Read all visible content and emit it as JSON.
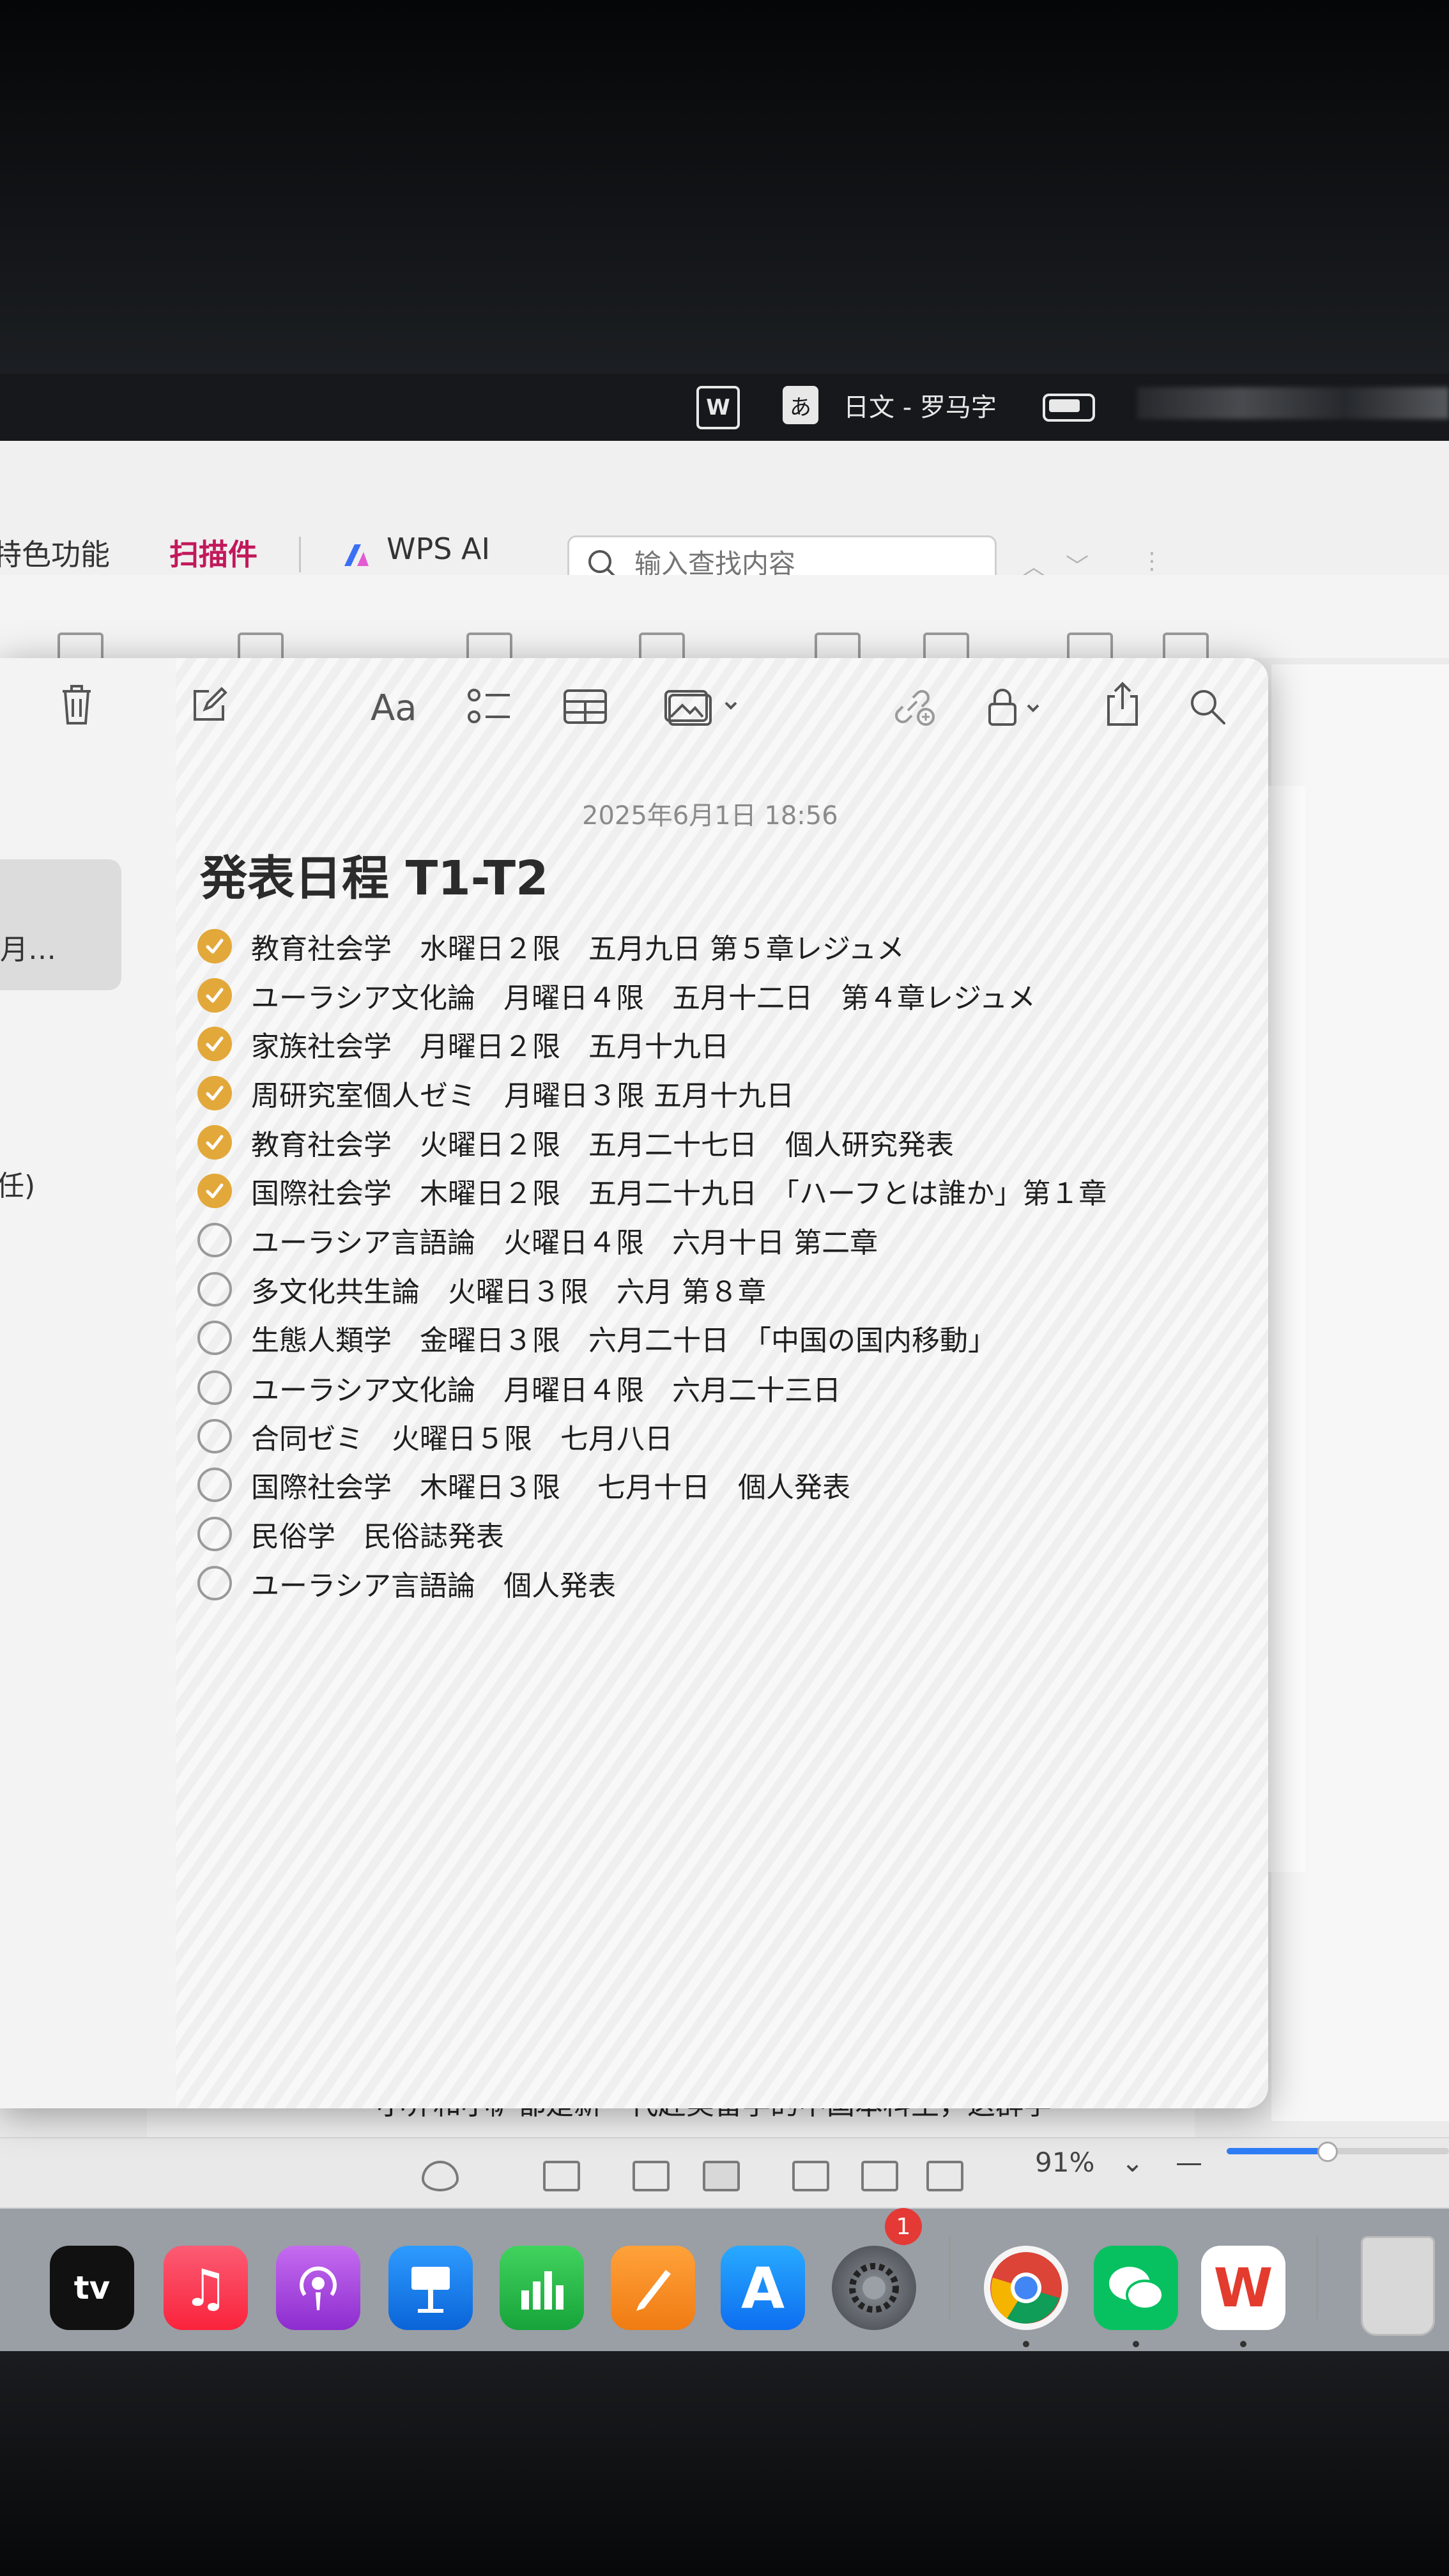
{
  "menubar": {
    "wps_icon": "wps-logo-icon",
    "input_source": "あ",
    "ime_name": "日文 - 罗马字"
  },
  "wps": {
    "tabs": [
      "特色功能",
      "扫描件",
      "WPS AI"
    ],
    "search_placeholder": "输入查找内容",
    "doc_text": "小乔和小萨都是新一代赴美留学的中国本科生，这群学",
    "zoom": "91%",
    "accent": "#c2185b"
  },
  "sidebar": {
    "note_preview": "月…",
    "fragment": "任)"
  },
  "note": {
    "date": "2025年6月1日 18:56",
    "title": "発表日程 T1-T2",
    "check_color": "#e3a83a",
    "tasks": [
      {
        "text": "教育社会学　水曜日２限　五月九日 第５章レジュメ",
        "done": true
      },
      {
        "text": "ユーラシア文化論　月曜日４限　五月十二日　第４章レジュメ",
        "done": true
      },
      {
        "text": "家族社会学　月曜日２限　五月十九日",
        "done": true
      },
      {
        "text": "周研究室個人ゼミ　月曜日３限 五月十九日",
        "done": true
      },
      {
        "text": "教育社会学　火曜日２限　五月二十七日　個人研究発表",
        "done": true
      },
      {
        "text": "国際社会学　木曜日２限　五月二十九日　「ハーフとは誰か」第１章",
        "done": true
      },
      {
        "text": "ユーラシア言語論　火曜日４限　六月十日 第二章",
        "done": false
      },
      {
        "text": "多文化共生論　火曜日３限　六月 第８章",
        "done": false
      },
      {
        "text": "生態人類学　金曜日３限　六月二十日　「中国の国内移動」",
        "done": false
      },
      {
        "text": "ユーラシア文化論　月曜日４限　六月二十三日",
        "done": false
      },
      {
        "text": "合同ゼミ　火曜日５限　七月八日",
        "done": false
      },
      {
        "text": "国際社会学　木曜日３限　 七月十日　個人発表",
        "done": false
      },
      {
        "text": "民俗学　民俗誌発表",
        "done": false
      },
      {
        "text": "ユーラシア言語論　個人発表",
        "done": false
      }
    ]
  },
  "dock": {
    "apps": [
      "tv",
      "music",
      "podcasts",
      "keynote",
      "numbers",
      "pages",
      "app-store",
      "system-settings",
      "chrome",
      "wechat",
      "wps",
      "trash"
    ],
    "tv_label": "tv",
    "settings_badge": "1"
  }
}
